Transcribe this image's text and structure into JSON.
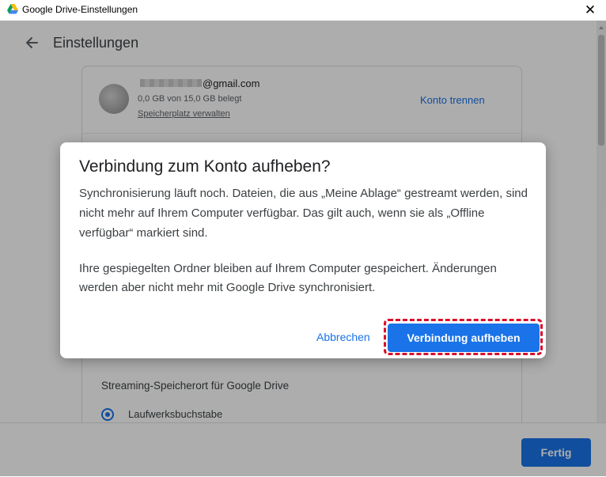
{
  "window": {
    "title": "Google Drive-Einstellungen",
    "app_icon": "google-drive-icon",
    "close_glyph": "✕"
  },
  "page": {
    "title": "Einstellungen",
    "account": {
      "email_suffix": "@gmail.com",
      "storage": "0,0 GB von 15,0 GB belegt",
      "manage_link": "Speicherplatz verwalten",
      "disconnect_link": "Konto trennen"
    },
    "streaming": {
      "section_title": "Streaming-Speicherort für Google Drive",
      "option_label": "Laufwerksbuchstabe",
      "option_selected": true
    },
    "done_button": "Fertig"
  },
  "dialog": {
    "title": "Verbindung zum Konto aufheben?",
    "paragraph1": "Synchronisierung läuft noch. Dateien, die aus „Meine Ablage“ gestreamt werden, sind nicht mehr auf Ihrem Computer verfügbar. Das gilt auch, wenn sie als „Offline verfügbar“ markiert sind.",
    "paragraph2": "Ihre gespiegelten Ordner bleiben auf Ihrem Computer gespeichert. Änderungen werden aber nicht mehr mit Google Drive synchronisiert.",
    "cancel_button": "Abbrechen",
    "confirm_button": "Verbindung aufheben"
  },
  "colors": {
    "accent": "#1a73e8",
    "highlight": "#d8102a"
  }
}
